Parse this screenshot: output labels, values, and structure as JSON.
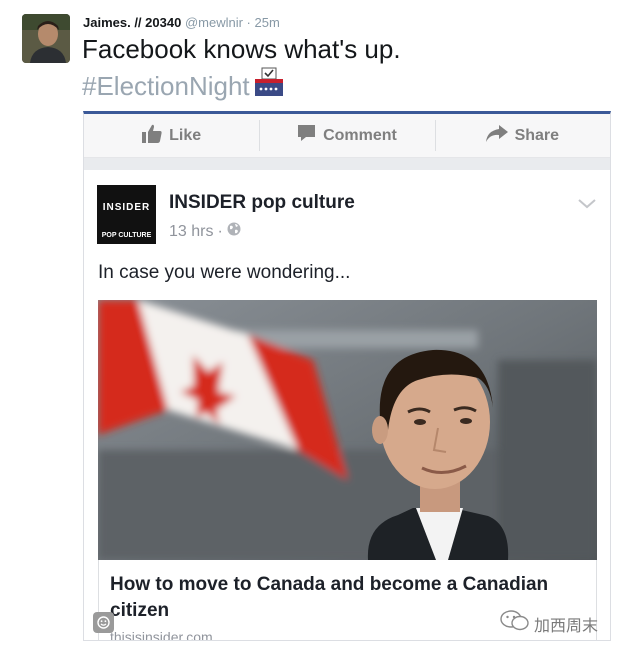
{
  "tweet": {
    "display_name": "Jaimes. // 20340",
    "handle": "@mewlnir",
    "separator": "·",
    "time": "25m",
    "text": "Facebook knows what's up.",
    "hashtag": "#ElectionNight",
    "emoji": "ballot-box-icon"
  },
  "facebook_embed": {
    "actions": [
      {
        "label": "Like",
        "icon": "thumbs-up-icon"
      },
      {
        "label": "Comment",
        "icon": "comment-icon"
      },
      {
        "label": "Share",
        "icon": "share-arrow-icon"
      }
    ],
    "post": {
      "page_logo": {
        "line1": "INSIDER",
        "line2": "POP CULTURE"
      },
      "page_name": "INSIDER pop culture",
      "time": "13 hrs",
      "separator": "·",
      "audience_icon": "globe-icon",
      "caption": "In case you were wondering...",
      "link": {
        "title": "How to move to Canada and become a Canadian citizen",
        "source": "thisisinsider.com"
      }
    }
  },
  "overlay": {
    "watermark_text": "加西周末"
  },
  "colors": {
    "facebook_blue": "#3b5998",
    "hashtag_gray": "#9aa6b1",
    "action_gray": "#7f7f7f",
    "canada_red": "#d52b1e"
  }
}
